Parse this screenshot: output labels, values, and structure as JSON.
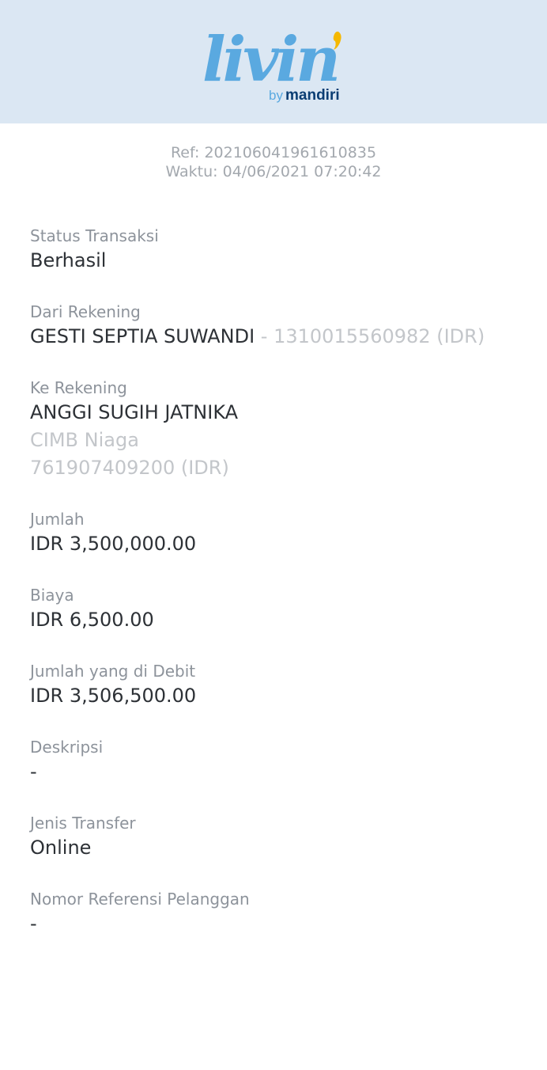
{
  "brand": {
    "logo_text": "livin'",
    "byline_by": "by",
    "byline_brand": "mandiri",
    "colors": {
      "header_bg": "#dbe7f3",
      "logo_blue": "#5aa9e0",
      "logo_accent": "#f5b800",
      "mandiri_navy": "#0a3d73"
    }
  },
  "receipt": {
    "ref": "Ref: 202106041961610835",
    "time": "Waktu: 04/06/2021 07:20:42"
  },
  "fields": {
    "status": {
      "label": "Status Transaksi",
      "value": "Berhasil"
    },
    "from": {
      "label": "Dari Rekening",
      "name": "GESTI SEPTIA SUWANDI",
      "account": " - 1310015560982 (IDR)"
    },
    "to": {
      "label": "Ke Rekening",
      "name": "ANGGI SUGIH JATNIKA",
      "bank": "CIMB Niaga",
      "account": "761907409200 (IDR)"
    },
    "amount": {
      "label": "Jumlah",
      "value": "IDR 3,500,000.00"
    },
    "fee": {
      "label": "Biaya",
      "value": "IDR 6,500.00"
    },
    "debited": {
      "label": "Jumlah yang di Debit",
      "value": "IDR 3,506,500.00"
    },
    "description": {
      "label": "Deskripsi",
      "value": "-"
    },
    "transfer_type": {
      "label": "Jenis Transfer",
      "value": "Online"
    },
    "customer_ref": {
      "label": "Nomor Referensi Pelanggan",
      "value": "-"
    }
  }
}
